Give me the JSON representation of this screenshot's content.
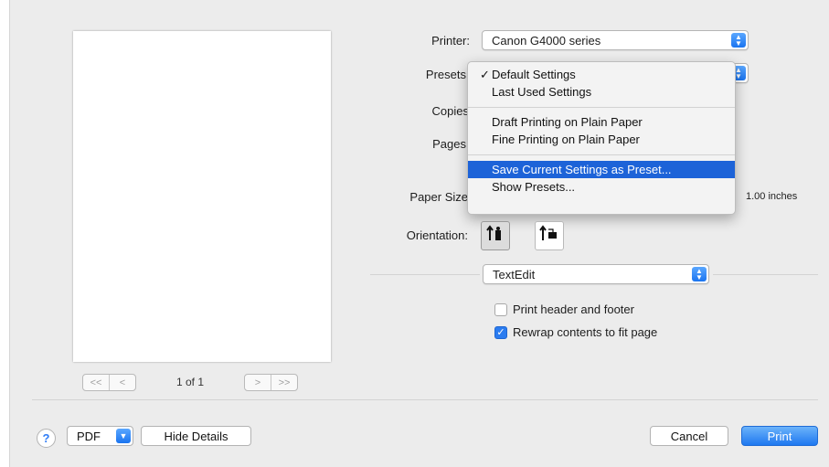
{
  "printer": {
    "label": "Printer:",
    "value": "Canon G4000 series"
  },
  "presets": {
    "label": "Presets",
    "checkmark": "✓",
    "menu_items": [
      {
        "label": "Default Settings",
        "checked": true
      },
      {
        "label": "Last Used Settings"
      },
      {
        "label": "Draft Printing on Plain Paper"
      },
      {
        "label": "Fine Printing on Plain Paper"
      },
      {
        "label": "Save Current Settings as Preset...",
        "highlighted": true
      },
      {
        "label": "Show Presets..."
      }
    ]
  },
  "copies": {
    "label": "Copies"
  },
  "pages": {
    "label": "Pages"
  },
  "paper_size": {
    "label": "Paper Size",
    "trailing_text": "1.00 inches"
  },
  "orientation": {
    "label": "Orientation:"
  },
  "app_popup": {
    "value": "TextEdit"
  },
  "options": {
    "header_footer": {
      "label": "Print header and footer",
      "checked": false
    },
    "rewrap": {
      "label": "Rewrap contents to fit page",
      "checked": true
    }
  },
  "pager": {
    "first": "<<",
    "prev": "<",
    "next": ">",
    "last": ">>",
    "count": "1 of 1"
  },
  "footer": {
    "help": "?",
    "pdf": "PDF",
    "hide_details": "Hide Details",
    "cancel": "Cancel",
    "print": "Print"
  },
  "colors": {
    "accent": "#1e78f0",
    "highlight": "#1d63d8"
  }
}
